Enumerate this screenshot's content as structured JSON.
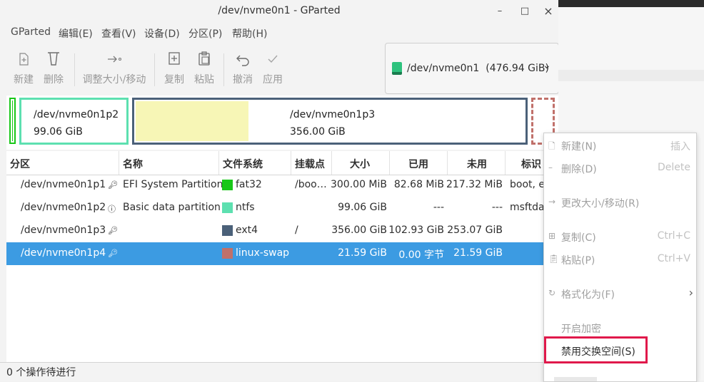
{
  "window": {
    "title": "/dev/nvme0n1 - GParted",
    "controls": {
      "minimize": "–",
      "maximize": "□",
      "close": "×"
    }
  },
  "menubar": [
    "GParted",
    "编辑(E)",
    "查看(V)",
    "设备(D)",
    "分区(P)",
    "帮助(H)"
  ],
  "toolbar": {
    "new": "新建",
    "delete": "删除",
    "resize": "调整大小/移动",
    "copy": "复制",
    "paste": "粘贴",
    "undo": "撤消",
    "apply": "应用"
  },
  "device": {
    "name": "/dev/nvme0n1",
    "size": "(476.94 GiB)"
  },
  "visual": {
    "p2": {
      "name": "/dev/nvme0n1p2",
      "size": "99.06 GiB"
    },
    "p3": {
      "name": "/dev/nvme0n1p3",
      "size": "356.00 GiB",
      "used_fraction": 0.29
    }
  },
  "table": {
    "headers": [
      "分区",
      "名称",
      "文件系统",
      "挂载点",
      "大小",
      "已用",
      "未用",
      "标识"
    ],
    "rows": [
      {
        "partition": "/dev/nvme0n1p1",
        "lock": "key-icon",
        "name": "EFI System Partition",
        "fs": "fat32",
        "fs_color": "#18c718",
        "mount": "/boo…",
        "size": "300.00 MiB",
        "used": "82.68 MiB",
        "unused": "217.32 MiB",
        "flags": "boot, e"
      },
      {
        "partition": "/dev/nvme0n1p2",
        "lock": "info-icon",
        "name": "Basic data partition",
        "fs": "ntfs",
        "fs_color": "#5de0b0",
        "mount": "",
        "size": "99.06 GiB",
        "used": "---",
        "unused": "---",
        "flags": "msftda"
      },
      {
        "partition": "/dev/nvme0n1p3",
        "lock": "key-icon",
        "name": "",
        "fs": "ext4",
        "fs_color": "#4b6179",
        "mount": "/",
        "size": "356.00 GiB",
        "used": "102.93 GiB",
        "unused": "253.07 GiB",
        "flags": ""
      },
      {
        "partition": "/dev/nvme0n1p4",
        "lock": "key-icon",
        "name": "",
        "fs": "linux-swap",
        "fs_color": "#c0706a",
        "mount": "",
        "size": "21.59 GiB",
        "used": "0.00 字节",
        "unused": "21.59 GiB",
        "flags": ""
      }
    ]
  },
  "status": "0 个操作待进行",
  "context_menu": {
    "new": "新建(N)",
    "new_key": "插入",
    "delete": "删除(D)",
    "delete_key": "Delete",
    "resize": "更改大小/移动(R)",
    "copy": "复制(C)",
    "copy_key": "Ctrl+C",
    "paste": "粘贴(P)",
    "paste_key": "Ctrl+V",
    "format": "格式化为(F)",
    "encrypt": "开启加密",
    "swapoff": "禁用交换空间(S)"
  },
  "colors": {
    "accent": "#3c9be2",
    "highlight_box": "#e0194b",
    "p2_border": "#5de0b0",
    "p3_border": "#4b6179",
    "p3_used": "#f7f6b6",
    "p4_border": "#c0706a"
  }
}
